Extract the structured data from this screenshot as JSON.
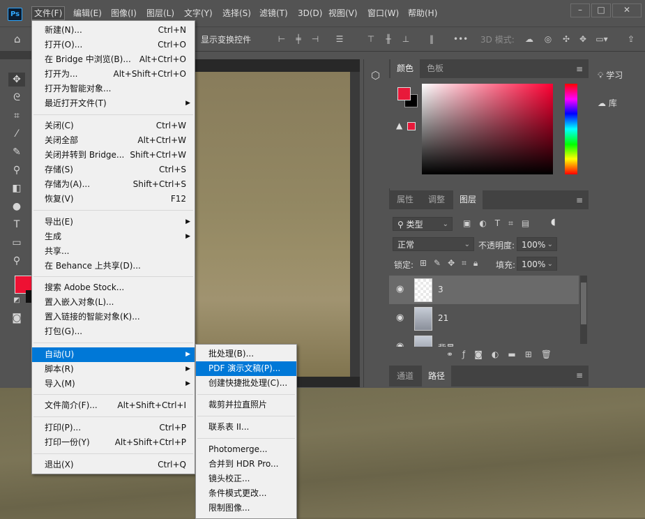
{
  "menubar": {
    "logo": "Ps",
    "items": [
      "文件(F)",
      "编辑(E)",
      "图像(I)",
      "图层(L)",
      "文字(Y)",
      "选择(S)",
      "滤镜(T)",
      "3D(D)",
      "视图(V)",
      "窗口(W)",
      "帮助(H)"
    ],
    "window_buttons": [
      "–",
      "□",
      "✕"
    ]
  },
  "optbar": {
    "show_transform": "显示变换控件",
    "mode_3d": "3D 模式:"
  },
  "file_menu": {
    "g1": [
      {
        "label": "新建(N)...",
        "shortcut": "Ctrl+N"
      },
      {
        "label": "打开(O)...",
        "shortcut": "Ctrl+O"
      },
      {
        "label": "在 Bridge 中浏览(B)...",
        "shortcut": "Alt+Ctrl+O"
      },
      {
        "label": "打开为...",
        "shortcut": "Alt+Shift+Ctrl+O"
      },
      {
        "label": "打开为智能对象...",
        "shortcut": ""
      },
      {
        "label": "最近打开文件(T)",
        "shortcut": ""
      }
    ],
    "g2": [
      {
        "label": "关闭(C)",
        "shortcut": "Ctrl+W"
      },
      {
        "label": "关闭全部",
        "shortcut": "Alt+Ctrl+W"
      },
      {
        "label": "关闭并转到 Bridge...",
        "shortcut": "Shift+Ctrl+W"
      },
      {
        "label": "存储(S)",
        "shortcut": "Ctrl+S"
      },
      {
        "label": "存储为(A)...",
        "shortcut": "Shift+Ctrl+S"
      },
      {
        "label": "恢复(V)",
        "shortcut": "F12"
      }
    ],
    "g3": [
      {
        "label": "导出(E)",
        "shortcut": ""
      },
      {
        "label": "生成",
        "shortcut": ""
      },
      {
        "label": "共享...",
        "shortcut": ""
      },
      {
        "label": "在 Behance 上共享(D)...",
        "shortcut": ""
      }
    ],
    "g4": [
      {
        "label": "搜索 Adobe Stock...",
        "shortcut": ""
      },
      {
        "label": "置入嵌入对象(L)...",
        "shortcut": ""
      },
      {
        "label": "置入链接的智能对象(K)...",
        "shortcut": ""
      },
      {
        "label": "打包(G)...",
        "shortcut": ""
      }
    ],
    "g5": [
      {
        "label": "自动(U)",
        "shortcut": ""
      },
      {
        "label": "脚本(R)",
        "shortcut": ""
      },
      {
        "label": "导入(M)",
        "shortcut": ""
      }
    ],
    "g6": [
      {
        "label": "文件简介(F)...",
        "shortcut": "Alt+Shift+Ctrl+I"
      }
    ],
    "g7": [
      {
        "label": "打印(P)...",
        "shortcut": "Ctrl+P"
      },
      {
        "label": "打印一份(Y)",
        "shortcut": "Alt+Shift+Ctrl+P"
      }
    ],
    "g8": [
      {
        "label": "退出(X)",
        "shortcut": "Ctrl+Q"
      }
    ]
  },
  "auto_submenu": {
    "g1": [
      "批处理(B)...",
      "PDF 演示文稿(P)...",
      "创建快捷批处理(C)..."
    ],
    "g2": [
      "裁剪并拉直照片"
    ],
    "g3": [
      "联系表 II..."
    ],
    "g4": [
      "Photomerge...",
      "合并到 HDR Pro...",
      "镜头校正...",
      "条件模式更改...",
      "限制图像..."
    ]
  },
  "color_panel": {
    "tabs": [
      "颜色",
      "色板"
    ],
    "foreground": "#e8193a",
    "background": "#000000"
  },
  "layers_panel": {
    "tabs": [
      "属性",
      "调整",
      "图层"
    ],
    "filter_kind": "类型",
    "blend_mode": "正常",
    "opacity_label": "不透明度:",
    "opacity_value": "100%",
    "lock_label": "锁定:",
    "fill_label": "填充:",
    "fill_value": "100%",
    "layers": [
      "3",
      "21",
      "背景"
    ],
    "selected_layer": "3"
  },
  "channels_panel": {
    "tabs": [
      "通道",
      "路径"
    ]
  },
  "learn_panel": {
    "items": [
      "学习",
      "库"
    ]
  },
  "colors": {
    "ui_bg": "#535353",
    "highlight": "#0078d7",
    "menu_bg": "#f0f0f0"
  }
}
